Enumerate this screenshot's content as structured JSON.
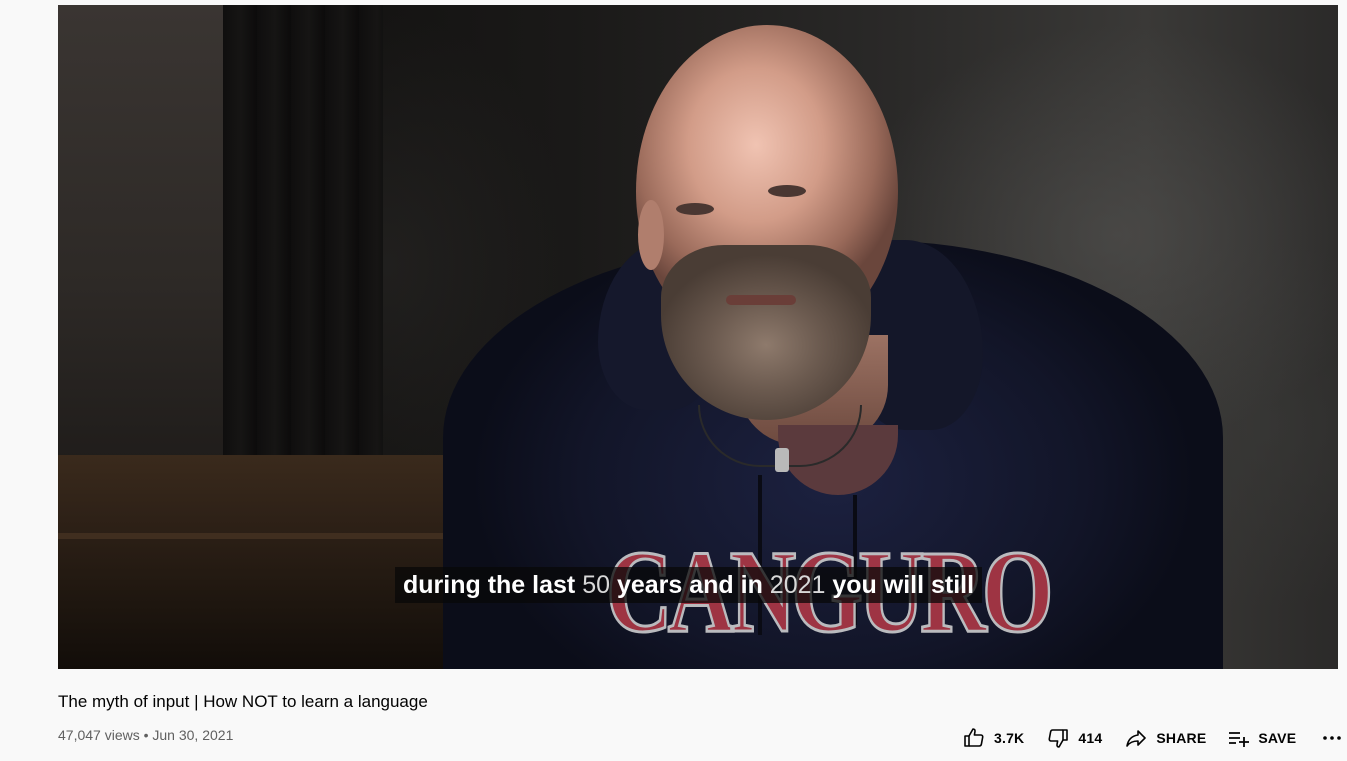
{
  "player": {
    "caption_segments": [
      {
        "text": "during the last ",
        "style": "bright"
      },
      {
        "text": "50",
        "style": "dim"
      },
      {
        "text": " years and in ",
        "style": "bright"
      },
      {
        "text": "2021",
        "style": "dim"
      },
      {
        "text": " you will still",
        "style": "bright"
      }
    ],
    "hoodie_print_text": "CANGURO"
  },
  "video": {
    "title": "The myth of input | How NOT to learn a language",
    "meta": "47,047 views • Jun 30, 2021"
  },
  "actions": {
    "like_count": "3.7K",
    "dislike_count": "414",
    "share_label": "SHARE",
    "save_label": "SAVE"
  },
  "icons": {
    "like": "thumbs-up-icon",
    "dislike": "thumbs-down-icon",
    "share": "share-arrow-icon",
    "save": "playlist-add-icon",
    "more": "more-horizontal-icon"
  },
  "colors": {
    "page_background": "#f9f9f9",
    "title_text": "#030303",
    "meta_text": "#606060",
    "caption_background": "#080808",
    "hoodie_print": "#b73a48"
  }
}
